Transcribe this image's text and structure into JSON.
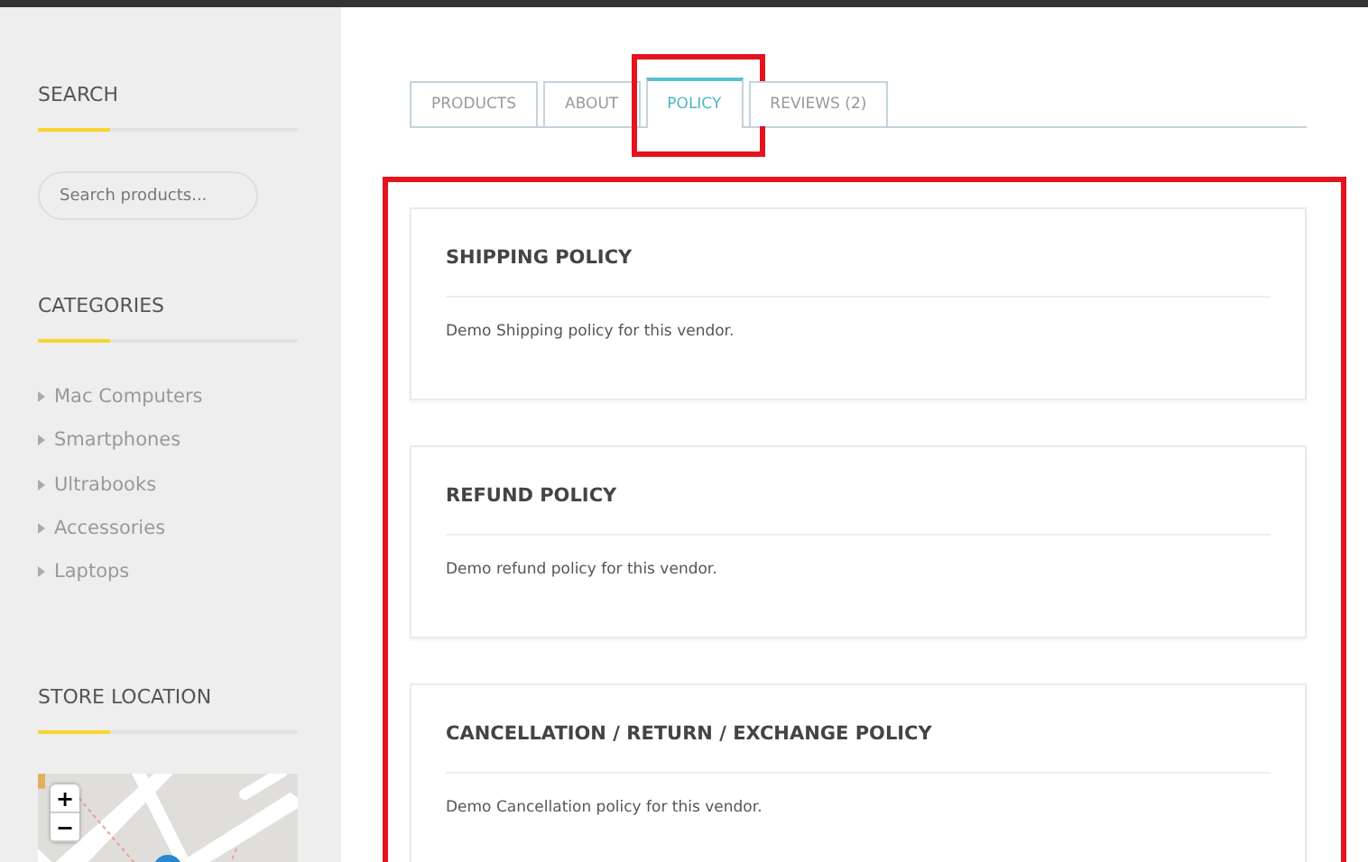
{
  "sidebar": {
    "widgets": [
      {
        "kind": "search",
        "title": "SEARCH",
        "placeholder": "Search products..."
      },
      {
        "kind": "list",
        "title": "CATEGORIES",
        "items": [
          "Mac Computers",
          "Smartphones",
          "Ultrabooks",
          "Accessories",
          "Laptops"
        ]
      },
      {
        "kind": "map",
        "title": "STORE LOCATION",
        "zoom_in": "+",
        "zoom_out": "−"
      }
    ]
  },
  "tabs": [
    {
      "label": "PRODUCTS",
      "selected": false,
      "highlighted": false
    },
    {
      "label": "ABOUT",
      "selected": false,
      "highlighted": false
    },
    {
      "label": "POLICY",
      "selected": true,
      "highlighted": true
    },
    {
      "label": "REVIEWS (2)",
      "selected": false,
      "highlighted": false
    }
  ],
  "policies_highlighted": true,
  "policies": [
    {
      "title": "SHIPPING POLICY",
      "text": "Demo Shipping policy for this vendor."
    },
    {
      "title": "REFUND POLICY",
      "text": "Demo refund policy for this vendor."
    },
    {
      "title": "CANCELLATION / RETURN / EXCHANGE POLICY",
      "text": "Demo Cancellation policy for this vendor."
    }
  ]
}
